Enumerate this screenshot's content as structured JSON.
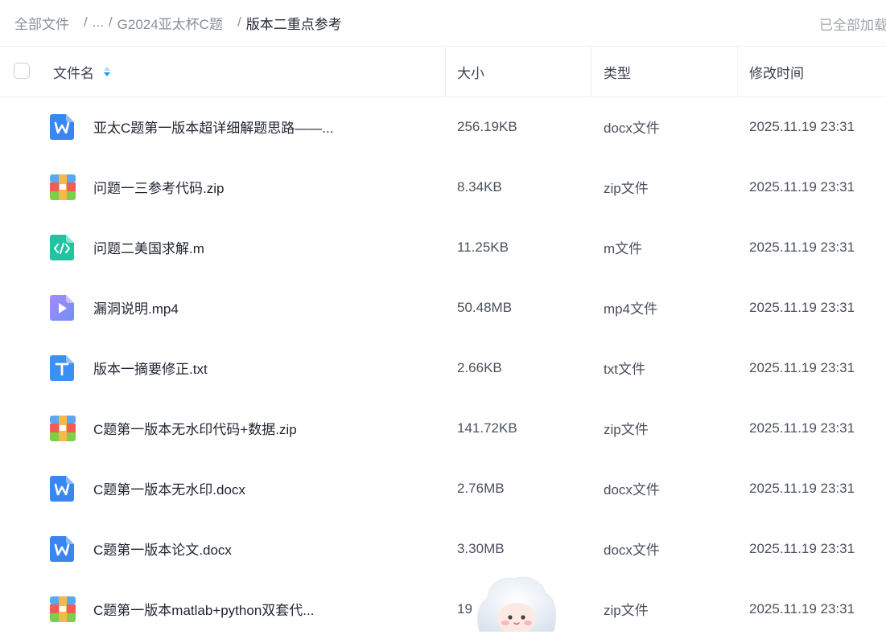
{
  "breadcrumb": {
    "root": "全部文件",
    "ellipsis": "...",
    "parent": "G2024亚太杯C题",
    "current": "版本二重点参考",
    "separator": "/",
    "loaded_status": "已全部加载"
  },
  "table": {
    "columns": {
      "name": "文件名",
      "size": "大小",
      "type": "类型",
      "modified": "修改时间"
    },
    "rows": [
      {
        "icon": "word-doc-icon",
        "name": "亚太C题第一版本超详细解题思路——...",
        "size": "256.19KB",
        "type": "docx文件",
        "modified": "2025.11.19 23:31"
      },
      {
        "icon": "zip-archive-icon",
        "name": "问题一三参考代码.zip",
        "size": "8.34KB",
        "type": "zip文件",
        "modified": "2025.11.19 23:31"
      },
      {
        "icon": "code-file-icon",
        "name": "问题二美国求解.m",
        "size": "11.25KB",
        "type": "m文件",
        "modified": "2025.11.19 23:31"
      },
      {
        "icon": "video-file-icon",
        "name": "漏洞说明.mp4",
        "size": "50.48MB",
        "type": "mp4文件",
        "modified": "2025.11.19 23:31"
      },
      {
        "icon": "text-file-icon",
        "name": "版本一摘要修正.txt",
        "size": "2.66KB",
        "type": "txt文件",
        "modified": "2025.11.19 23:31"
      },
      {
        "icon": "zip-archive-icon",
        "name": "C题第一版本无水印代码+数据.zip",
        "size": "141.72KB",
        "type": "zip文件",
        "modified": "2025.11.19 23:31"
      },
      {
        "icon": "word-doc-icon",
        "name": "C题第一版本无水印.docx",
        "size": "2.76MB",
        "type": "docx文件",
        "modified": "2025.11.19 23:31"
      },
      {
        "icon": "word-doc-icon",
        "name": "C题第一版本论文.docx",
        "size": "3.30MB",
        "type": "docx文件",
        "modified": "2025.11.19 23:31"
      },
      {
        "icon": "zip-archive-icon",
        "name": "C题第一版本matlab+python双套代...",
        "size": "19",
        "type": "zip文件",
        "modified": "2025.11.19 23:31"
      }
    ]
  },
  "colors": {
    "word": "#3a86f0",
    "code": "#22c3a0",
    "video": "#8b7cf6",
    "text": "#3b8ff5",
    "accent_sort": "#1e9bf0"
  }
}
